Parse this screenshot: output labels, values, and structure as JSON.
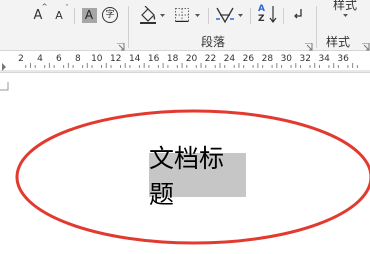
{
  "ribbon": {
    "font_group": {
      "grow_font_glyph": "A",
      "shrink_font_glyph": "A",
      "char_shading_glyph": "A",
      "phonetic_glyph": "字"
    },
    "paragraph_group": {
      "label": "段落",
      "sort_glyph_a": "A",
      "sort_glyph_z": "Z"
    },
    "styles_group": {
      "label": "样式",
      "gallery_label": "样式"
    }
  },
  "ruler": {
    "numbers": [
      "2",
      "4",
      "6",
      "8",
      "10",
      "12",
      "14",
      "16",
      "18",
      "20",
      "22",
      "24",
      "26",
      "28",
      "30",
      "32",
      "34",
      "36"
    ]
  },
  "document": {
    "title_text": "文档标题",
    "ellipse_color": "#e23a2f",
    "highlight_color": "#c6c6c6"
  }
}
